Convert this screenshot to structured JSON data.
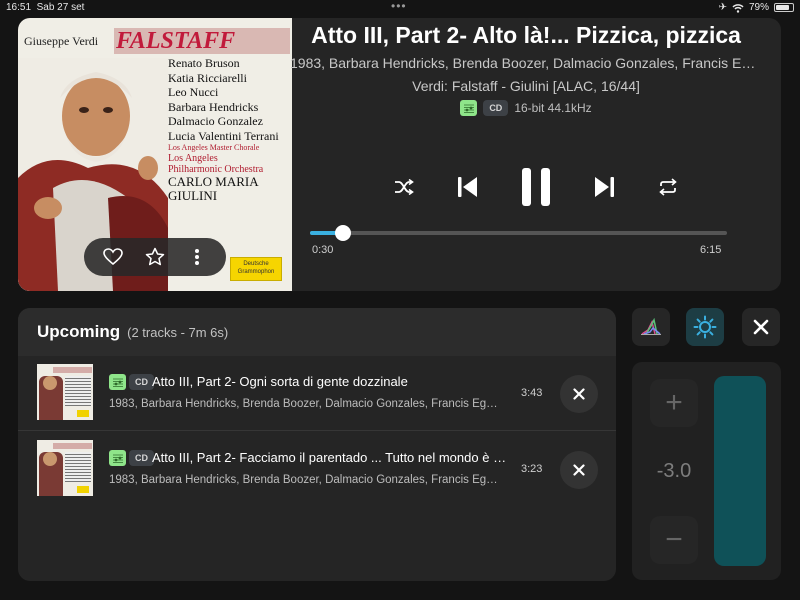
{
  "status_bar": {
    "time": "16:51",
    "date": "Sab 27 set",
    "battery": "79%",
    "battery_level": 0.79
  },
  "album_cover": {
    "composer": "Giuseppe Verdi",
    "title": "FALSTAFF",
    "credits": [
      "Renato Bruson",
      "Katia Ricciarelli",
      "Leo Nucci",
      "Barbara Hendricks",
      "Dalmacio Gonzalez",
      "Lucia Valentini Terrani"
    ],
    "chorale": "Los Angeles Master Chorale",
    "orchestra": [
      "Los Angeles",
      "Philharmonic Orchestra"
    ],
    "conductor": [
      "CARLO MARIA",
      "GIULINI"
    ],
    "label_logo": "Deutsche Grammophon"
  },
  "now_playing": {
    "title": "Atto III, Part 2- Alto là!... Pizzica, pizzica",
    "artists": "1983, Barbara Hendricks, Brenda Boozer, Dalmacio Gonzales, Francis Egerton",
    "album": "Verdi: Falstaff - Giulini [ALAC, 16/44]",
    "format_badge": "CD",
    "format": "16-bit 44.1kHz",
    "elapsed": "0:30",
    "total": "6:15",
    "progress": 0.08
  },
  "art_actions": {
    "icons": [
      "heart-icon",
      "star-icon",
      "more-vertical-icon"
    ]
  },
  "controls": {
    "icons": [
      "shuffle-icon",
      "previous-icon",
      "pause-icon",
      "next-icon",
      "repeat-icon"
    ]
  },
  "queue": {
    "title": "Upcoming",
    "meta": "(2 tracks - 7m 6s)",
    "items": [
      {
        "badge": "CD",
        "title": "Atto III, Part 2- Ogni sorta di gente dozzinale",
        "artists": "1983, Barbara Hendricks, Brenda Boozer, Dalmacio Gonzales, Francis Egerton",
        "duration": "3:43"
      },
      {
        "badge": "CD",
        "title": "Atto III, Part 2- Facciamo il parentado ... Tutto nel mondo è burla",
        "artists": "1983, Barbara Hendricks, Brenda Boozer, Dalmacio Gonzales, Francis Egerton",
        "duration": "3:23"
      }
    ]
  },
  "volume": {
    "value": "-3.0",
    "level": 1.0
  },
  "colors": {
    "accent": "#3ab0e0",
    "volume_bar": "#0f5158",
    "score_badge": "#8fe58a",
    "active_button": "#1d3d44"
  }
}
